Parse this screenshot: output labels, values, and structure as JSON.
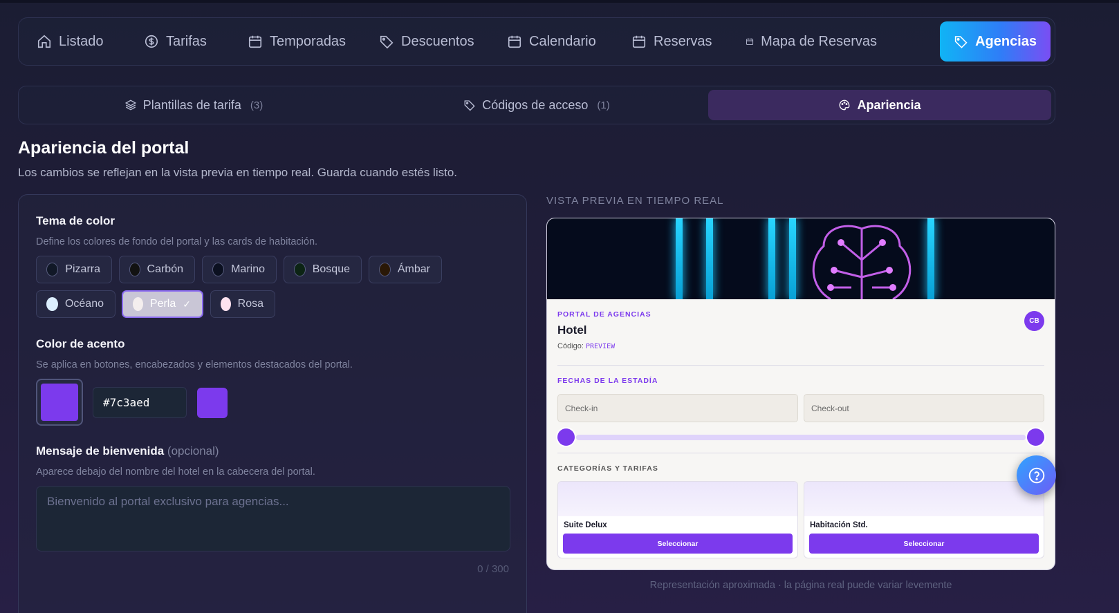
{
  "nav": {
    "items": [
      {
        "label": "Listado",
        "icon": "home-icon"
      },
      {
        "label": "Tarifas",
        "icon": "dollar-icon"
      },
      {
        "label": "Temporadas",
        "icon": "calendar-icon"
      },
      {
        "label": "Descuentos",
        "icon": "tag-icon"
      },
      {
        "label": "Calendario",
        "icon": "calendar-icon"
      },
      {
        "label": "Reservas",
        "icon": "calendar-icon"
      },
      {
        "label": "Mapa de Reservas",
        "icon": "calendar-icon"
      },
      {
        "label": "Agencias",
        "icon": "tag-icon",
        "active": true
      }
    ]
  },
  "subtabs": [
    {
      "label": "Plantillas de tarifa",
      "count": "(3)",
      "icon": "layers-icon"
    },
    {
      "label": "Códigos de acceso",
      "count": "(1)",
      "icon": "tag-icon"
    },
    {
      "label": "Apariencia",
      "count": "",
      "icon": "palette-icon",
      "active": true
    }
  ],
  "page": {
    "title": "Apariencia del portal",
    "lead": "Los cambios se reflejan en la vista previa en tiempo real. Guarda cuando estés listo."
  },
  "theme": {
    "title": "Tema de color",
    "desc": "Define los colores de fondo del portal y las cards de habitación.",
    "options": [
      {
        "label": "Pizarra",
        "color": "#111827"
      },
      {
        "label": "Carbón",
        "color": "#121212"
      },
      {
        "label": "Marino",
        "color": "#0b1020"
      },
      {
        "label": "Bosque",
        "color": "#0c2414"
      },
      {
        "label": "Ámbar",
        "color": "#2a1806"
      },
      {
        "label": "Océano",
        "color": "#dbeefe"
      },
      {
        "label": "Perla",
        "color": "#f4eeee",
        "selected": true
      },
      {
        "label": "Rosa",
        "color": "#fde2ef"
      }
    ],
    "selected_mark": "✓"
  },
  "accent": {
    "title": "Color de acento",
    "desc": "Se aplica en botones, encabezados y elementos destacados del portal.",
    "hex": "#7c3aed"
  },
  "welcome": {
    "title": "Mensaje de bienvenida",
    "optional": "(opcional)",
    "desc": "Aparece debajo del nombre del hotel en la cabecera del portal.",
    "placeholder": "Bienvenido al portal exclusivo para agencias...",
    "counter": "0 / 300"
  },
  "preview": {
    "label": "VISTA PREVIA EN TIEMPO REAL",
    "kicker": "PORTAL DE AGENCIAS",
    "hotel": "Hotel",
    "code_label": "Código:",
    "code_value": "PREVIEW",
    "avatar": "CB",
    "dates_title": "FECHAS DE LA ESTADÍA",
    "checkin": "Check-in",
    "checkout": "Check-out",
    "categories_title": "CATEGORÍAS Y TARIFAS",
    "rooms": [
      {
        "name": "Suite Delux",
        "button": "Seleccionar"
      },
      {
        "name": "Habitación Std.",
        "button": "Seleccionar"
      }
    ],
    "footnote": "Representación aproximada · la página real puede variar levemente"
  }
}
